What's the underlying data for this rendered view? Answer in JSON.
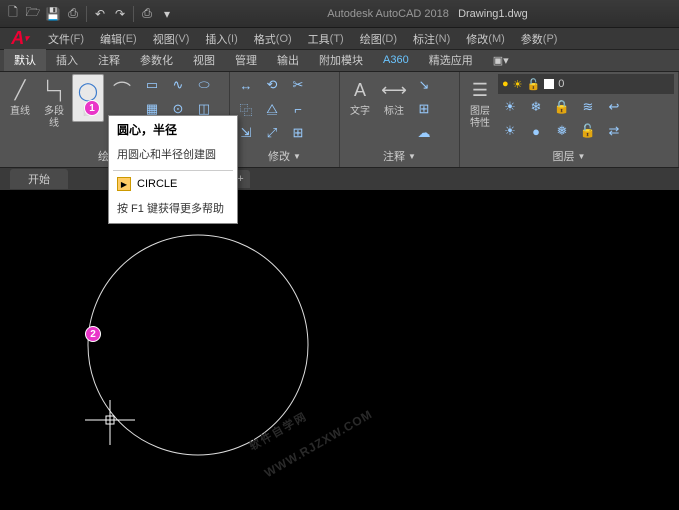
{
  "title": {
    "app": "Autodesk AutoCAD 2018",
    "file": "Drawing1.dwg"
  },
  "menus": [
    {
      "label": "文件",
      "accel": "(F)"
    },
    {
      "label": "编辑",
      "accel": "(E)"
    },
    {
      "label": "视图",
      "accel": "(V)"
    },
    {
      "label": "插入",
      "accel": "(I)"
    },
    {
      "label": "格式",
      "accel": "(O)"
    },
    {
      "label": "工具",
      "accel": "(T)"
    },
    {
      "label": "绘图",
      "accel": "(D)"
    },
    {
      "label": "标注",
      "accel": "(N)"
    },
    {
      "label": "修改",
      "accel": "(M)"
    },
    {
      "label": "参数",
      "accel": "(P)"
    }
  ],
  "ribbon_tabs": [
    {
      "label": "默认",
      "active": true
    },
    {
      "label": "插入"
    },
    {
      "label": "注释"
    },
    {
      "label": "参数化"
    },
    {
      "label": "视图"
    },
    {
      "label": "管理"
    },
    {
      "label": "输出"
    },
    {
      "label": "附加模块"
    },
    {
      "label": "A360",
      "a360": true
    },
    {
      "label": "精选应用"
    }
  ],
  "panels": {
    "draw": {
      "title": "绘图",
      "line": "直线",
      "polyline": "多段线",
      "circle": "圆"
    },
    "modify": {
      "title": "修改"
    },
    "annotate": {
      "title": "注释",
      "text": "文字",
      "dim": "标注"
    },
    "layers": {
      "title": "图层",
      "props": "图层\n特性"
    }
  },
  "file_tab": {
    "label": "开始"
  },
  "tooltip": {
    "title": "圆心，半径",
    "desc": "用圆心和半径创建圆",
    "cmd": "CIRCLE",
    "help": "按 F1 键获得更多帮助"
  },
  "badges": {
    "b1": "1",
    "b2": "2"
  },
  "watermark": {
    "main": "软件自学网",
    "sub": "WWW.RJZXW.COM"
  }
}
